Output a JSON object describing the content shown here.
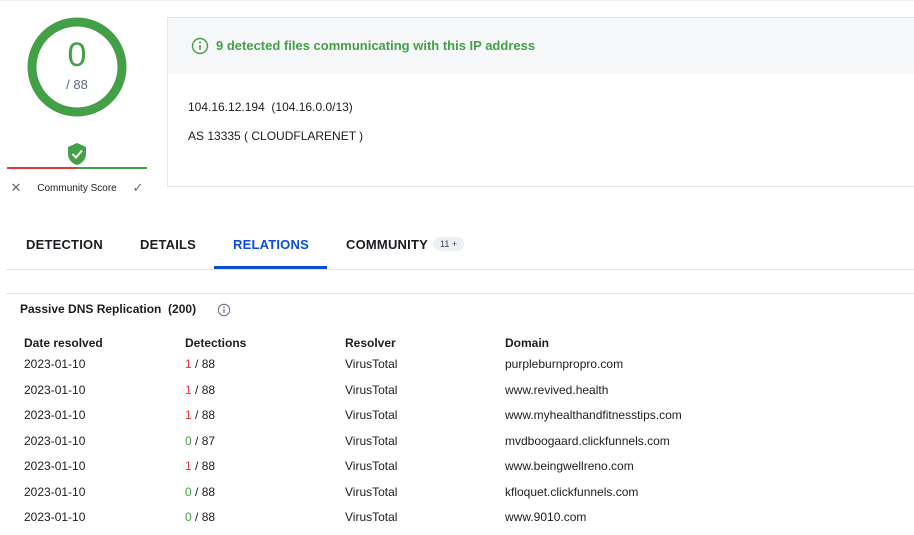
{
  "score": {
    "value": "0",
    "total": "/ 88",
    "community_label": "Community Score"
  },
  "info": {
    "message": "9 detected files communicating with this IP address",
    "ip_line": "104.16.12.194  (104.16.0.0/13)",
    "as_line": "AS 13335 ( CLOUDFLARENET )"
  },
  "tabs": [
    {
      "label": "DETECTION"
    },
    {
      "label": "DETAILS"
    },
    {
      "label": "RELATIONS",
      "active": true
    },
    {
      "label": "COMMUNITY",
      "badge": "11 +"
    }
  ],
  "section": {
    "title": "Passive DNS Replication  (200)"
  },
  "table": {
    "headers": [
      "Date resolved",
      "Detections",
      "Resolver",
      "Domain"
    ],
    "rows": [
      {
        "date": "2023-01-10",
        "det": "1",
        "total": " / 88",
        "resolver": "VirusTotal",
        "domain": "purpleburnpropro.com"
      },
      {
        "date": "2023-01-10",
        "det": "1",
        "total": " / 88",
        "resolver": "VirusTotal",
        "domain": "www.revived.health"
      },
      {
        "date": "2023-01-10",
        "det": "1",
        "total": " / 88",
        "resolver": "VirusTotal",
        "domain": "www.myhealthandfitnesstips.com"
      },
      {
        "date": "2023-01-10",
        "det": "0",
        "total": " / 87",
        "resolver": "VirusTotal",
        "domain": "mvdboogaard.clickfunnels.com"
      },
      {
        "date": "2023-01-10",
        "det": "1",
        "total": " / 88",
        "resolver": "VirusTotal",
        "domain": "www.beingwellreno.com"
      },
      {
        "date": "2023-01-10",
        "det": "0",
        "total": " / 88",
        "resolver": "VirusTotal",
        "domain": "kfloquet.clickfunnels.com"
      },
      {
        "date": "2023-01-10",
        "det": "0",
        "total": " / 88",
        "resolver": "VirusTotal",
        "domain": "www.9010.com"
      }
    ]
  },
  "colors": {
    "green": "#43a047",
    "red": "#e53935",
    "accent": "#0b4dda"
  }
}
